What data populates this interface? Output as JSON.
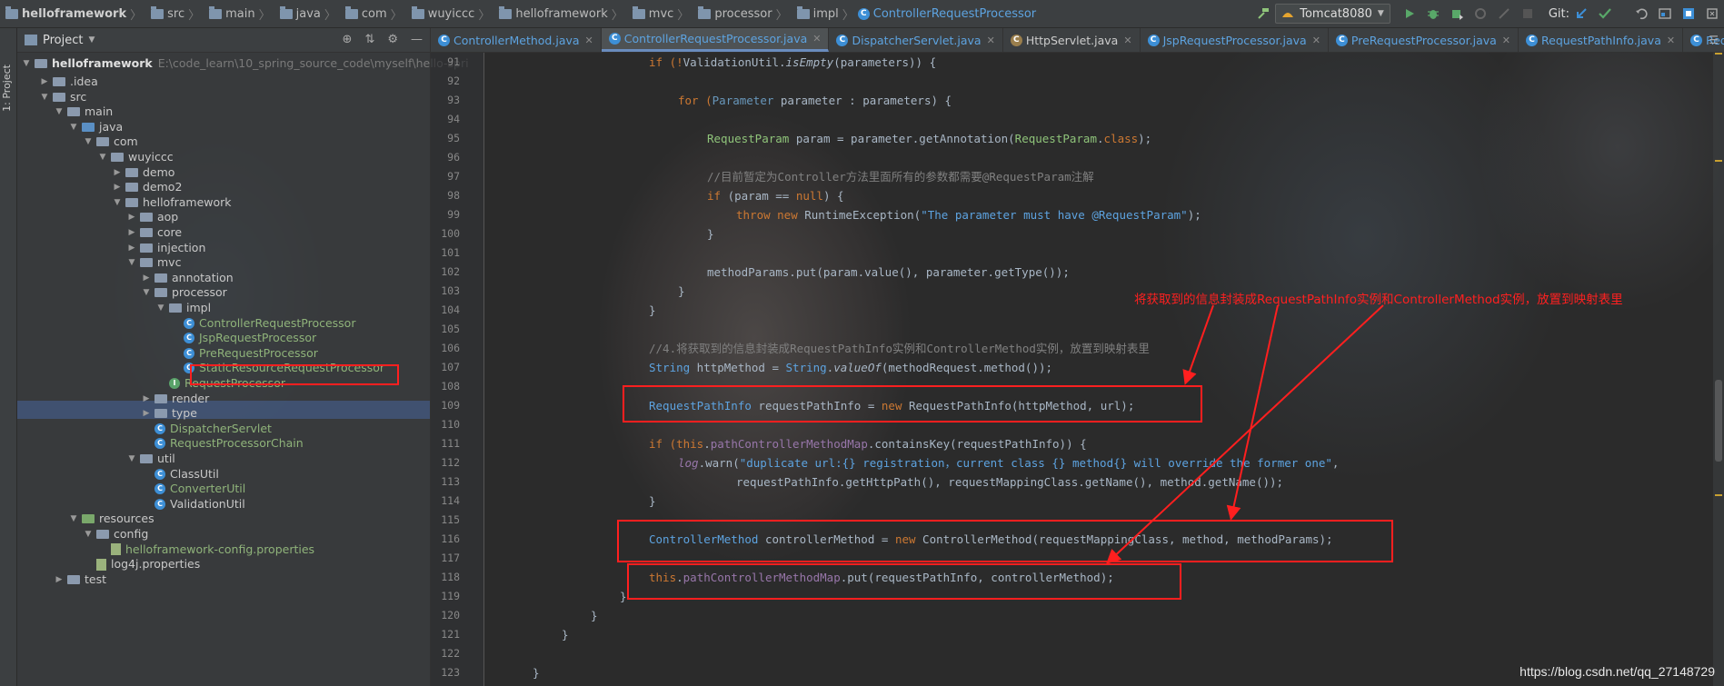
{
  "breadcrumb": [
    "helloframework",
    "src",
    "main",
    "java",
    "com",
    "wuyiccc",
    "helloframework",
    "mvc",
    "processor",
    "impl",
    "ControllerRequestProcessor"
  ],
  "run_config": "Tomcat8080",
  "vcs_label": "Git:",
  "sidebar_strip_label": "1: Project",
  "project_panel": {
    "title": "Project",
    "root_name": "helloframework",
    "root_path": "E:\\code_learn\\10_spring_source_code\\myself\\hello-spri",
    "items": [
      {
        "label": ".idea",
        "kind": "folder"
      },
      {
        "label": "src",
        "kind": "folder"
      },
      {
        "label": "main",
        "kind": "folder"
      },
      {
        "label": "java",
        "kind": "folder-src"
      },
      {
        "label": "com",
        "kind": "folder"
      },
      {
        "label": "wuyiccc",
        "kind": "folder"
      },
      {
        "label": "demo",
        "kind": "folder"
      },
      {
        "label": "demo2",
        "kind": "folder"
      },
      {
        "label": "helloframework",
        "kind": "folder"
      },
      {
        "label": "aop",
        "kind": "folder"
      },
      {
        "label": "core",
        "kind": "folder"
      },
      {
        "label": "injection",
        "kind": "folder"
      },
      {
        "label": "mvc",
        "kind": "folder"
      },
      {
        "label": "annotation",
        "kind": "folder"
      },
      {
        "label": "processor",
        "kind": "folder"
      },
      {
        "label": "impl",
        "kind": "folder"
      },
      {
        "label": "ControllerRequestProcessor",
        "kind": "class"
      },
      {
        "label": "JspRequestProcessor",
        "kind": "class"
      },
      {
        "label": "PreRequestProcessor",
        "kind": "class"
      },
      {
        "label": "StaticResourceRequestProcessor",
        "kind": "class"
      },
      {
        "label": "RequestProcessor",
        "kind": "interface"
      },
      {
        "label": "render",
        "kind": "folder"
      },
      {
        "label": "type",
        "kind": "folder"
      },
      {
        "label": "DispatcherServlet",
        "kind": "class"
      },
      {
        "label": "RequestProcessorChain",
        "kind": "class"
      },
      {
        "label": "util",
        "kind": "folder"
      },
      {
        "label": "ClassUtil",
        "kind": "class"
      },
      {
        "label": "ConverterUtil",
        "kind": "class"
      },
      {
        "label": "ValidationUtil",
        "kind": "class"
      },
      {
        "label": "resources",
        "kind": "folder-res"
      },
      {
        "label": "config",
        "kind": "folder"
      },
      {
        "label": "helloframework-config.properties",
        "kind": "properties"
      },
      {
        "label": "log4j.properties",
        "kind": "properties"
      },
      {
        "label": "test",
        "kind": "folder"
      }
    ]
  },
  "tabs": [
    {
      "label": "ControllerMethod.java"
    },
    {
      "label": "ControllerRequestProcessor.java"
    },
    {
      "label": "DispatcherServlet.java"
    },
    {
      "label": "HttpServlet.java"
    },
    {
      "label": "JspRequestProcessor.java"
    },
    {
      "label": "PreRequestProcessor.java"
    },
    {
      "label": "RequestPathInfo.java"
    },
    {
      "label": "Reque"
    }
  ],
  "line_numbers": [
    "91",
    "92",
    "93",
    "94",
    "95",
    "96",
    "97",
    "98",
    "99",
    "100",
    "101",
    "102",
    "103",
    "104",
    "105",
    "106",
    "107",
    "108",
    "109",
    "110",
    "111",
    "112",
    "113",
    "114",
    "115",
    "116",
    "117",
    "118",
    "119",
    "120",
    "121",
    "122",
    "123"
  ],
  "code": {
    "l91": [
      "if (!",
      "ValidationUtil",
      ".",
      "isEmpty",
      "(parameters)) {"
    ],
    "l93": [
      "for (",
      "Parameter",
      " parameter : parameters) {"
    ],
    "l95": [
      "RequestParam",
      " param = parameter.getAnnotation(",
      "RequestParam",
      ".",
      "class",
      ");"
    ],
    "l97": "//目前暂定为Controller方法里面所有的参数都需要@RequestParam注解",
    "l98": [
      "if",
      " (param == ",
      "null",
      ") {"
    ],
    "l99": [
      "throw new",
      " RuntimeException(",
      "\"The parameter must have @RequestParam\"",
      ");"
    ],
    "l100": "}",
    "l102": "methodParams.put(param.value(), parameter.getType());",
    "l103": "}",
    "l104": "}",
    "l106": "//4.将获取到的信息封装成RequestPathInfo实例和ControllerMethod实例，放置到映射表里",
    "l107": [
      "String",
      " httpMethod = ",
      "String",
      ".",
      "valueOf",
      "(methodRequest.method());"
    ],
    "l109": [
      "RequestPathInfo",
      " requestPathInfo = ",
      "new",
      " RequestPathInfo(httpMethod, url);"
    ],
    "l111": [
      "if (",
      "this",
      ".",
      "pathControllerMethodMap",
      ".containsKey(requestPathInfo)) {"
    ],
    "l112": [
      "log",
      ".warn(",
      "\"duplicate url:{} registration，current class {} method{} will override the former one\"",
      ","
    ],
    "l113": "requestPathInfo.getHttpPath(), requestMappingClass.getName(), method.getName());",
    "l114": "}",
    "l116": [
      "ControllerMethod",
      " controllerMethod = ",
      "new",
      " ControllerMethod(requestMappingClass, method, methodParams);"
    ],
    "l118": [
      "this",
      ".",
      "pathControllerMethodMap",
      ".put(requestPathInfo, controllerMethod);"
    ],
    "l119": "}",
    "l120": "}",
    "l121": "}",
    "l123": "}"
  },
  "annotation_text": "将获取到的信息封装成RequestPathInfo实例和ControllerMethod实例，放置到映射表里",
  "watermark": "https://blog.csdn.net/qq_27148729"
}
